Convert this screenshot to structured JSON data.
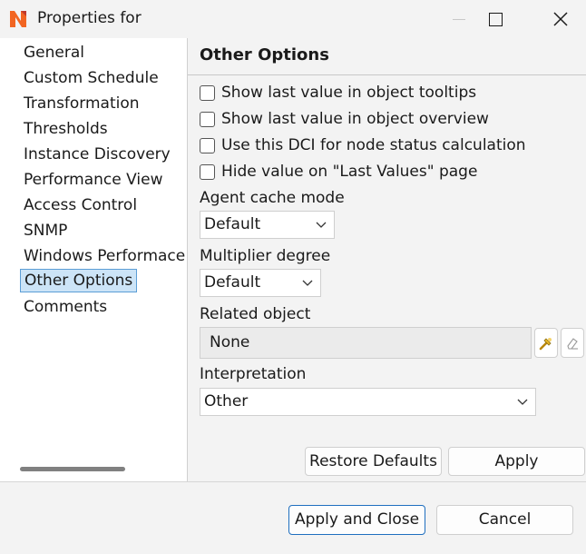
{
  "window": {
    "title": "Properties for",
    "controls": {
      "minimize": "minimize-icon",
      "maximize": "maximize-icon",
      "close": "close-icon"
    }
  },
  "nav": {
    "items": [
      {
        "label": "General"
      },
      {
        "label": "Custom Schedule"
      },
      {
        "label": "Transformation"
      },
      {
        "label": "Thresholds"
      },
      {
        "label": "Instance Discovery"
      },
      {
        "label": "Performance View"
      },
      {
        "label": "Access Control"
      },
      {
        "label": "SNMP"
      },
      {
        "label": "Windows Performace Counters"
      },
      {
        "label": "Other Options",
        "selected": true
      },
      {
        "label": "Comments"
      }
    ]
  },
  "page": {
    "title": "Other Options",
    "checkboxes": [
      {
        "label": "Show last value in object tooltips",
        "checked": false
      },
      {
        "label": "Show last value in object overview",
        "checked": false
      },
      {
        "label": "Use this DCI for node status calculation",
        "checked": false
      },
      {
        "label": "Hide value on \"Last Values\" page",
        "checked": false
      }
    ],
    "agent_cache": {
      "label": "Agent cache mode",
      "value": "Default"
    },
    "multiplier": {
      "label": "Multiplier degree",
      "value": "Default"
    },
    "related_object": {
      "label": "Related object",
      "value": "None"
    },
    "interpretation": {
      "label": "Interpretation",
      "value": "Other"
    },
    "restore_defaults_label": "Restore Defaults",
    "apply_label": "Apply"
  },
  "footer": {
    "apply_close_label": "Apply and Close",
    "cancel_label": "Cancel"
  },
  "colors": {
    "accent": "#1f6fbf",
    "selection": "#cce4f7",
    "logo": "#f26522"
  }
}
